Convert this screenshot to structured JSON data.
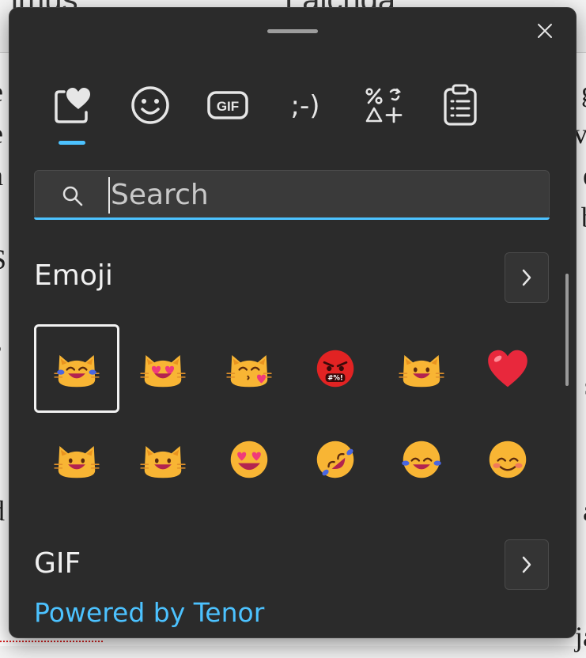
{
  "background": {
    "topbar_left": "imus",
    "topbar_right": "Lalcnda",
    "left_letters": "e\ne\na\nt\nS\n\ns\n,\n\n\nd\n\n\nj",
    "right_letters": "g\nvi\ne\nb\n\n\nj\ns\n\n\na\n\n\nja"
  },
  "panel": {
    "close_label": "✕",
    "tabs": [
      {
        "name": "favorites",
        "icon": "heart-in-box-icon"
      },
      {
        "name": "emoji",
        "icon": "smiley-face-icon"
      },
      {
        "name": "gif",
        "icon": "gif-icon",
        "label": "GIF"
      },
      {
        "name": "kaomoji",
        "icon": "kaomoji-icon",
        "label": ";-)"
      },
      {
        "name": "symbols",
        "icon": "symbols-icon"
      },
      {
        "name": "clipboard",
        "icon": "clipboard-icon"
      }
    ],
    "search": {
      "placeholder": "Search",
      "value": ""
    },
    "emoji_section": {
      "title": "Emoji"
    },
    "emoji": [
      {
        "name": "cat-with-tears-of-joy",
        "kind": "cat-joy"
      },
      {
        "name": "smiling-cat-with-heart-eyes",
        "kind": "cat-hearts"
      },
      {
        "name": "kissing-cat",
        "kind": "cat-kiss"
      },
      {
        "name": "face-with-symbols-on-mouth",
        "kind": "angry"
      },
      {
        "name": "grinning-cat",
        "kind": "cat-grin"
      },
      {
        "name": "red-heart",
        "kind": "heart"
      },
      {
        "name": "grinning-cat-with-smiling-eyes",
        "kind": "cat-grin"
      },
      {
        "name": "grinning-cat-alt",
        "kind": "cat-grin"
      },
      {
        "name": "smiling-face-with-heart-eyes",
        "kind": "face-hearts"
      },
      {
        "name": "rolling-on-the-floor-laughing",
        "kind": "rofl"
      },
      {
        "name": "face-with-tears-of-joy",
        "kind": "face-joy"
      },
      {
        "name": "smiling-face-with-smiling-eyes",
        "kind": "face-smile"
      }
    ],
    "gif_section": {
      "title": "GIF",
      "powered_by": "Powered by Tenor"
    },
    "colors": {
      "accent": "#4cc2ff",
      "panel": "#2b2b2b",
      "emoji_yellow": "#f8b534"
    }
  }
}
